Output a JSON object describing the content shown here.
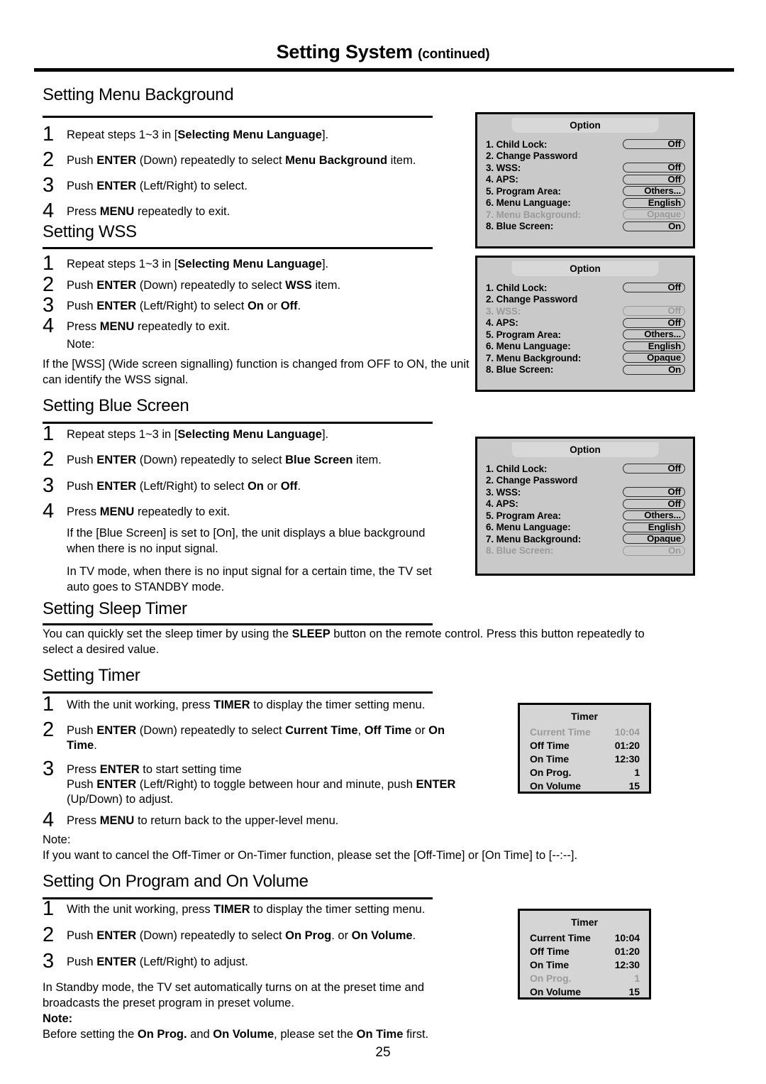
{
  "header": {
    "title_main": "Setting System",
    "title_suffix": "(continued)"
  },
  "page_number": "25",
  "sections": {
    "menu_background": {
      "heading": "Setting Menu Background",
      "steps": [
        {
          "num": "1",
          "text_html": "Repeat steps 1~3 in [<b>Selecting Menu Language</b>]."
        },
        {
          "num": "2",
          "text_html": "Push <b>ENTER</b> (Down) repeatedly to select <b>Menu Background</b> item."
        },
        {
          "num": "3",
          "text_html": "Push <b>ENTER</b> (Left/Right) to select."
        },
        {
          "num": "4",
          "text_html": "Press <b>MENU</b> repeatedly to exit."
        }
      ]
    },
    "wss": {
      "heading": "Setting WSS",
      "steps": [
        {
          "num": "1",
          "text_html": "Repeat steps 1~3 in [<b>Selecting Menu Language</b>]."
        },
        {
          "num": "2",
          "text_html": "Push <b>ENTER</b> (Down) repeatedly to select <b>WSS</b> item."
        },
        {
          "num": "3",
          "text_html": "Push <b>ENTER</b> (Left/Right) to select <b>On</b> or <b>Off</b>."
        },
        {
          "num": "4",
          "text_html": "Press <b>MENU</b> repeatedly to exit."
        }
      ],
      "note_label": "Note:",
      "note_body": "If the [WSS] (Wide screen signalling) function is changed from OFF to ON, the unit can identify the WSS signal."
    },
    "blue_screen": {
      "heading": "Setting Blue Screen",
      "steps": [
        {
          "num": "1",
          "text_html": "Repeat steps 1~3 in [<b>Selecting Menu Language</b>]."
        },
        {
          "num": "2",
          "text_html": "Push <b>ENTER</b> (Down) repeatedly to select <b>Blue Screen</b> item."
        },
        {
          "num": "3",
          "text_html": "Push <b>ENTER</b> (Left/Right) to select <b>On</b> or <b>Off</b>."
        },
        {
          "num": "4",
          "text_html": "Press <b>MENU</b> repeatedly to exit."
        }
      ],
      "para1": "If the [Blue Screen] is set to [On], the unit displays a blue background when there is no input signal.",
      "para2": "In TV mode, when there is no input signal for a certain time, the TV set auto goes to STANDBY mode."
    },
    "sleep_timer": {
      "heading": "Setting Sleep Timer",
      "body_html": "You can quickly set the sleep timer by using the <b>SLEEP</b> button on the remote control. Press this button repeatedly to select a desired value."
    },
    "timer": {
      "heading": "Setting Timer",
      "steps": [
        {
          "num": "1",
          "text_html": "With the unit working, press <b>TIMER</b> to display the timer setting menu."
        },
        {
          "num": "2",
          "text_html": "Push <b>ENTER</b> (Down) repeatedly to select <b>Current Time</b>, <b>Off Time</b> or <b>On Time</b>."
        },
        {
          "num": "3",
          "text_html": "Press <b>ENTER</b> to start setting time<br>Push <b>ENTER</b> (Left/Right) to toggle between hour and minute, push <b>ENTER</b> (Up/Down) to adjust."
        },
        {
          "num": "4",
          "text_html": "Press <b>MENU</b> to return back to the upper-level menu."
        }
      ],
      "note_label": "Note:",
      "note_body": "If you want to cancel the Off-Timer or On-Timer function, please set the [Off-Time] or [On Time] to [--:--]."
    },
    "on_program": {
      "heading": "Setting On Program and On Volume",
      "steps": [
        {
          "num": "1",
          "text_html": "With the unit working, press <b>TIMER</b> to display the timer setting menu."
        },
        {
          "num": "2",
          "text_html": "Push <b>ENTER</b> (Down) repeatedly to select <b>On Prog</b>. or <b>On Volume</b>."
        },
        {
          "num": "3",
          "text_html": "Push <b>ENTER</b> (Left/Right) to adjust."
        }
      ],
      "para_html": "In Standby mode, the TV set automatically turns on at the preset time and broadcasts the preset program in preset volume.",
      "note_label": "Note:",
      "note_body_html": "Before setting the <b>On Prog.</b> and <b>On Volume</b>, please set the <b>On Time</b> first."
    }
  },
  "osd_panels": {
    "option_1": {
      "title": "Option",
      "rows": [
        {
          "label": "1. Child Lock:",
          "value": "Off",
          "dim": false
        },
        {
          "label": "2. Change Password",
          "value": "",
          "dim": false
        },
        {
          "label": "3. WSS:",
          "value": "Off",
          "dim": false
        },
        {
          "label": "4. APS:",
          "value": "Off",
          "dim": false
        },
        {
          "label": "5. Program Area:",
          "value": "Others...",
          "dim": false
        },
        {
          "label": "6. Menu Language:",
          "value": "English",
          "dim": false
        },
        {
          "label": "7. Menu Background:",
          "value": "Opaque",
          "dim": true
        },
        {
          "label": "8. Blue Screen:",
          "value": "On",
          "dim": false
        }
      ]
    },
    "option_2": {
      "title": "Option",
      "rows": [
        {
          "label": "1. Child Lock:",
          "value": "Off",
          "dim": false
        },
        {
          "label": "2. Change Password",
          "value": "",
          "dim": false
        },
        {
          "label": "3. WSS:",
          "value": "Off",
          "dim": true
        },
        {
          "label": "4. APS:",
          "value": "Off",
          "dim": false
        },
        {
          "label": "5. Program Area:",
          "value": "Others...",
          "dim": false
        },
        {
          "label": "6. Menu Language:",
          "value": "English",
          "dim": false
        },
        {
          "label": "7. Menu Background:",
          "value": "Opaque",
          "dim": false
        },
        {
          "label": "8. Blue Screen:",
          "value": "On",
          "dim": false
        }
      ]
    },
    "option_3": {
      "title": "Option",
      "rows": [
        {
          "label": "1. Child Lock:",
          "value": "Off",
          "dim": false
        },
        {
          "label": "2. Change Password",
          "value": "",
          "dim": false
        },
        {
          "label": "3. WSS:",
          "value": "Off",
          "dim": false
        },
        {
          "label": "4. APS:",
          "value": "Off",
          "dim": false
        },
        {
          "label": "5. Program Area:",
          "value": "Others...",
          "dim": false
        },
        {
          "label": "6. Menu Language:",
          "value": "English",
          "dim": false
        },
        {
          "label": "7. Menu Background:",
          "value": "Opaque",
          "dim": false
        },
        {
          "label": "8. Blue Screen:",
          "value": "On",
          "dim": true
        }
      ]
    },
    "timer_1": {
      "title": "Timer",
      "rows": [
        {
          "label": "Current Time",
          "value": "10:04",
          "dim": true
        },
        {
          "label": "Off Time",
          "value": "01:20",
          "dim": false
        },
        {
          "label": "On Time",
          "value": "12:30",
          "dim": false
        },
        {
          "label": "On Prog.",
          "value": "1",
          "dim": false
        },
        {
          "label": "On Volume",
          "value": "15",
          "dim": false
        }
      ]
    },
    "timer_2": {
      "title": "Timer",
      "rows": [
        {
          "label": "Current Time",
          "value": "10:04",
          "dim": false
        },
        {
          "label": "Off Time",
          "value": "01:20",
          "dim": false
        },
        {
          "label": "On Time",
          "value": "12:30",
          "dim": false
        },
        {
          "label": "On Prog.",
          "value": "1",
          "dim": true
        },
        {
          "label": "On Volume",
          "value": "15",
          "dim": false
        }
      ]
    }
  },
  "colors": {
    "osd_option_bg": "#c9c9c9",
    "osd_titlebar_bg": "#d8d8d8",
    "osd_timer_bg": "#d5d5d5",
    "dim_text": "#9a9a9a",
    "text": "#000000"
  }
}
